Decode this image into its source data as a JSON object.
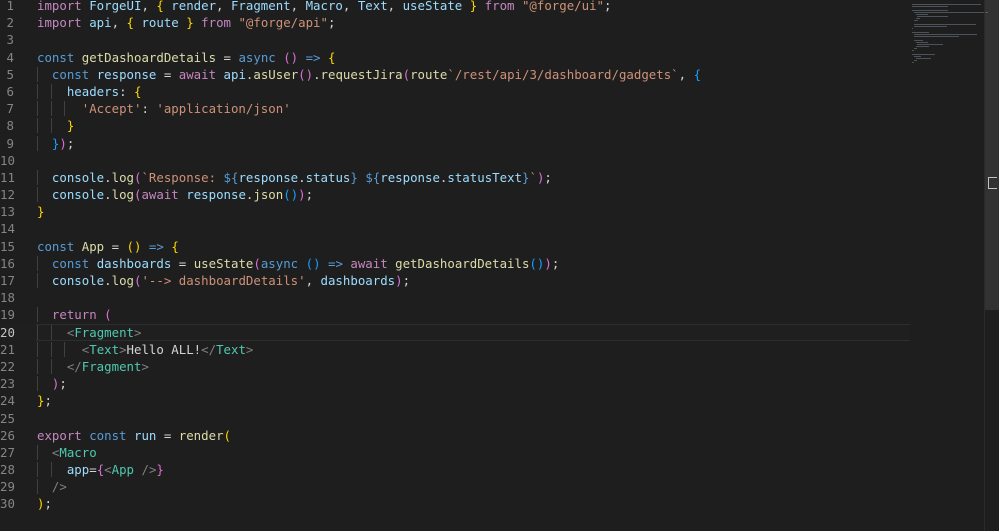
{
  "editor": {
    "current_line": 20,
    "lines": [
      {
        "n": "1",
        "tokens": [
          [
            "import ",
            "t-ctl"
          ],
          [
            "ForgeUI",
            "t-var"
          ],
          [
            ", ",
            "t-punc"
          ],
          [
            "{ ",
            "t-b1"
          ],
          [
            "render",
            "t-var"
          ],
          [
            ", ",
            "t-punc"
          ],
          [
            "Fragment",
            "t-var"
          ],
          [
            ", ",
            "t-punc"
          ],
          [
            "Macro",
            "t-var"
          ],
          [
            ", ",
            "t-punc"
          ],
          [
            "Text",
            "t-var"
          ],
          [
            ", ",
            "t-punc"
          ],
          [
            "useState",
            "t-var"
          ],
          [
            " }",
            "t-b1"
          ],
          [
            " from ",
            "t-ctl"
          ],
          [
            "\"@forge/ui\"",
            "t-str"
          ],
          [
            ";",
            "t-punc"
          ]
        ]
      },
      {
        "n": "2",
        "tokens": [
          [
            "import ",
            "t-ctl"
          ],
          [
            "api",
            "t-var"
          ],
          [
            ", ",
            "t-punc"
          ],
          [
            "{ ",
            "t-b1"
          ],
          [
            "route",
            "t-var"
          ],
          [
            " }",
            "t-b1"
          ],
          [
            " from ",
            "t-ctl"
          ],
          [
            "\"@forge/api\"",
            "t-str"
          ],
          [
            ";",
            "t-punc"
          ]
        ]
      },
      {
        "n": "3",
        "tokens": []
      },
      {
        "n": "4",
        "tokens": [
          [
            "const ",
            "t-kw"
          ],
          [
            "getDashoardDetails",
            "t-fn"
          ],
          [
            " = ",
            "t-punc"
          ],
          [
            "async ",
            "t-kw"
          ],
          [
            "()",
            "t-b2"
          ],
          [
            " => ",
            "t-kw"
          ],
          [
            "{",
            "t-b1"
          ]
        ]
      },
      {
        "n": "5",
        "tokens": [
          [
            "  "
          ],
          [
            "const ",
            "t-kw"
          ],
          [
            "response",
            "t-var"
          ],
          [
            " = ",
            "t-punc"
          ],
          [
            "await ",
            "t-ctl"
          ],
          [
            "api",
            "t-var"
          ],
          [
            ".",
            "t-punc"
          ],
          [
            "asUser",
            "t-fn"
          ],
          [
            "()",
            "t-b2"
          ],
          [
            ".",
            "t-punc"
          ],
          [
            "requestJira",
            "t-fn"
          ],
          [
            "(",
            "t-b2"
          ],
          [
            "route",
            "t-fn"
          ],
          [
            "`/rest/api/3/dashboard/gadgets`",
            "t-str"
          ],
          [
            ", ",
            "t-punc"
          ],
          [
            "{",
            "t-b3"
          ]
        ]
      },
      {
        "n": "6",
        "tokens": [
          [
            "    "
          ],
          [
            "headers",
            "t-var"
          ],
          [
            ": ",
            "t-punc"
          ],
          [
            "{",
            "t-b1"
          ]
        ]
      },
      {
        "n": "7",
        "tokens": [
          [
            "      "
          ],
          [
            "'Accept'",
            "t-str"
          ],
          [
            ": ",
            "t-punc"
          ],
          [
            "'application/json'",
            "t-str"
          ]
        ]
      },
      {
        "n": "8",
        "tokens": [
          [
            "    "
          ],
          [
            "}",
            "t-b1"
          ]
        ]
      },
      {
        "n": "9",
        "tokens": [
          [
            "  "
          ],
          [
            "}",
            "t-b3"
          ],
          [
            ")",
            "t-b2"
          ],
          [
            ";",
            "t-punc"
          ]
        ]
      },
      {
        "n": "10",
        "tokens": []
      },
      {
        "n": "11",
        "tokens": [
          [
            "  "
          ],
          [
            "console",
            "t-var"
          ],
          [
            ".",
            "t-punc"
          ],
          [
            "log",
            "t-fn"
          ],
          [
            "(",
            "t-b2"
          ],
          [
            "`Response: ",
            "t-str"
          ],
          [
            "${",
            "t-kw"
          ],
          [
            "response",
            "t-var"
          ],
          [
            ".",
            "t-punc"
          ],
          [
            "status",
            "t-var"
          ],
          [
            "}",
            "t-kw"
          ],
          [
            " ",
            "t-str"
          ],
          [
            "${",
            "t-kw"
          ],
          [
            "response",
            "t-var"
          ],
          [
            ".",
            "t-punc"
          ],
          [
            "statusText",
            "t-var"
          ],
          [
            "}",
            "t-kw"
          ],
          [
            "`",
            "t-str"
          ],
          [
            ")",
            "t-b2"
          ],
          [
            ";",
            "t-punc"
          ]
        ]
      },
      {
        "n": "12",
        "tokens": [
          [
            "  "
          ],
          [
            "console",
            "t-var"
          ],
          [
            ".",
            "t-punc"
          ],
          [
            "log",
            "t-fn"
          ],
          [
            "(",
            "t-b2"
          ],
          [
            "await ",
            "t-ctl"
          ],
          [
            "response",
            "t-var"
          ],
          [
            ".",
            "t-punc"
          ],
          [
            "json",
            "t-fn"
          ],
          [
            "()",
            "t-b3"
          ],
          [
            ")",
            "t-b2"
          ],
          [
            ";",
            "t-punc"
          ]
        ]
      },
      {
        "n": "13",
        "tokens": [
          [
            "}",
            "t-b1"
          ]
        ]
      },
      {
        "n": "14",
        "tokens": []
      },
      {
        "n": "15",
        "tokens": [
          [
            "const ",
            "t-kw"
          ],
          [
            "App",
            "t-fn"
          ],
          [
            " = ",
            "t-punc"
          ],
          [
            "()",
            "t-b1"
          ],
          [
            " => ",
            "t-kw"
          ],
          [
            "{",
            "t-b1"
          ]
        ]
      },
      {
        "n": "16",
        "tokens": [
          [
            "  "
          ],
          [
            "const ",
            "t-kw"
          ],
          [
            "dashboards",
            "t-var"
          ],
          [
            " = ",
            "t-punc"
          ],
          [
            "useState",
            "t-fn"
          ],
          [
            "(",
            "t-b2"
          ],
          [
            "async ",
            "t-kw"
          ],
          [
            "()",
            "t-b3"
          ],
          [
            " => ",
            "t-kw"
          ],
          [
            "await ",
            "t-ctl"
          ],
          [
            "getDashoardDetails",
            "t-fn"
          ],
          [
            "()",
            "t-b3"
          ],
          [
            ")",
            "t-b2"
          ],
          [
            ";",
            "t-punc"
          ]
        ]
      },
      {
        "n": "17",
        "tokens": [
          [
            "  "
          ],
          [
            "console",
            "t-var"
          ],
          [
            ".",
            "t-punc"
          ],
          [
            "log",
            "t-fn"
          ],
          [
            "(",
            "t-b2"
          ],
          [
            "'--> dashboardDetails'",
            "t-str"
          ],
          [
            ", ",
            "t-punc"
          ],
          [
            "dashboards",
            "t-var"
          ],
          [
            ")",
            "t-b2"
          ],
          [
            ";",
            "t-punc"
          ]
        ]
      },
      {
        "n": "18",
        "tokens": []
      },
      {
        "n": "19",
        "tokens": [
          [
            "  "
          ],
          [
            "return ",
            "t-ctl"
          ],
          [
            "(",
            "t-b2"
          ]
        ]
      },
      {
        "n": "20",
        "tokens": [
          [
            "    "
          ],
          [
            "<",
            "t-ang"
          ],
          [
            "Fragment",
            "t-tag"
          ],
          [
            ">",
            "t-ang"
          ]
        ]
      },
      {
        "n": "21",
        "tokens": [
          [
            "      "
          ],
          [
            "<",
            "t-ang"
          ],
          [
            "Text",
            "t-tag"
          ],
          [
            ">",
            "t-ang"
          ],
          [
            "Hello ALL!",
            "t-txt"
          ],
          [
            "</",
            "t-ang"
          ],
          [
            "Text",
            "t-tag"
          ],
          [
            ">",
            "t-ang"
          ]
        ]
      },
      {
        "n": "22",
        "tokens": [
          [
            "    "
          ],
          [
            "</",
            "t-ang"
          ],
          [
            "Fragment",
            "t-tag"
          ],
          [
            ">",
            "t-ang"
          ]
        ]
      },
      {
        "n": "23",
        "tokens": [
          [
            "  "
          ],
          [
            ")",
            "t-b2"
          ],
          [
            ";",
            "t-punc"
          ]
        ]
      },
      {
        "n": "24",
        "tokens": [
          [
            "}",
            "t-b1"
          ],
          [
            ";",
            "t-punc"
          ]
        ]
      },
      {
        "n": "25",
        "tokens": []
      },
      {
        "n": "26",
        "tokens": [
          [
            "export ",
            "t-ctl"
          ],
          [
            "const ",
            "t-kw"
          ],
          [
            "run",
            "t-var"
          ],
          [
            " = ",
            "t-punc"
          ],
          [
            "render",
            "t-fn"
          ],
          [
            "(",
            "t-b1"
          ]
        ]
      },
      {
        "n": "27",
        "tokens": [
          [
            "  "
          ],
          [
            "<",
            "t-ang"
          ],
          [
            "Macro",
            "t-tag"
          ]
        ]
      },
      {
        "n": "28",
        "tokens": [
          [
            "    "
          ],
          [
            "app",
            "t-var"
          ],
          [
            "=",
            "t-punc"
          ],
          [
            "{",
            "t-b2"
          ],
          [
            "<",
            "t-ang"
          ],
          [
            "App",
            "t-tag"
          ],
          [
            " />",
            "t-ang"
          ],
          [
            "}",
            "t-b2"
          ]
        ]
      },
      {
        "n": "29",
        "tokens": [
          [
            "  "
          ],
          [
            "/>",
            "t-ang"
          ]
        ]
      },
      {
        "n": "30",
        "tokens": [
          [
            ")",
            "t-b1"
          ],
          [
            ";",
            "t-punc"
          ]
        ]
      }
    ]
  },
  "colors": {
    "background": "#1e1e1e",
    "line_number": "#858585",
    "line_number_active": "#c6c6c6",
    "keyword": "#569cd6",
    "control": "#c586c0",
    "variable": "#9cdcfe",
    "function": "#dcdcaa",
    "string": "#ce9178",
    "tag": "#4ec9b0"
  }
}
